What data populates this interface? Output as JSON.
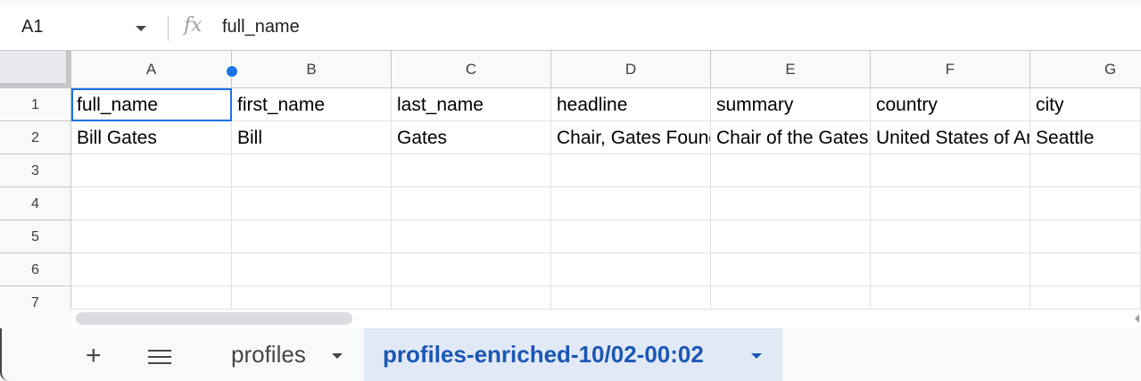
{
  "formula_bar": {
    "name_box": "A1",
    "fx_glyph": "fx",
    "formula": "full_name"
  },
  "columns": [
    "A",
    "B",
    "C",
    "D",
    "E",
    "F",
    "G"
  ],
  "rows": [
    "1",
    "2",
    "3",
    "4",
    "5",
    "6",
    "7"
  ],
  "cells": [
    [
      "full_name",
      "first_name",
      "last_name",
      "headline",
      "summary",
      "country",
      "city"
    ],
    [
      "Bill Gates",
      "Bill",
      "Gates",
      "Chair, Gates Foundation",
      "Chair of the Gates Foundation",
      "United States of America",
      "Seattle"
    ]
  ],
  "selected_cell": "A1",
  "sheet_tabs": {
    "add_label": "+",
    "tabs": [
      {
        "label": "profiles",
        "active": false
      },
      {
        "label": "profiles-enriched-10/02-00:02",
        "active": true
      }
    ]
  },
  "colors": {
    "selection": "#1a73e8",
    "active_tab_bg": "#e1e9f7",
    "active_tab_text": "#1a56b4"
  }
}
